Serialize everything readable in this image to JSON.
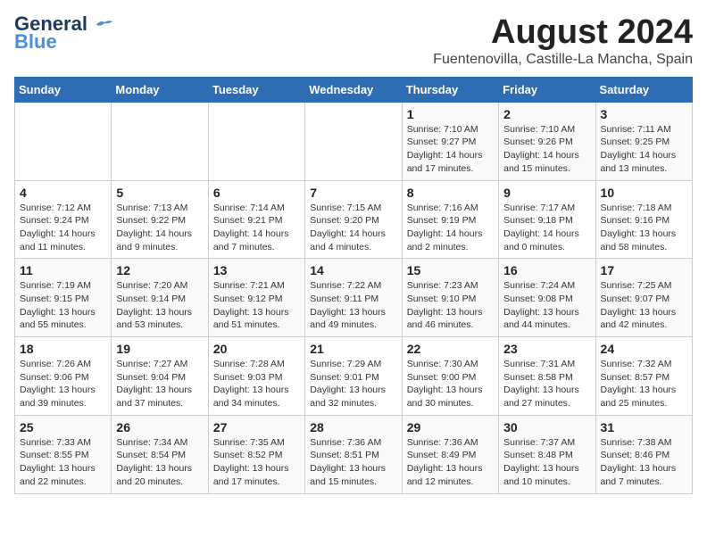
{
  "header": {
    "logo_line1": "General",
    "logo_line2": "Blue",
    "month_title": "August 2024",
    "location": "Fuentenovilla, Castille-La Mancha, Spain"
  },
  "weekdays": [
    "Sunday",
    "Monday",
    "Tuesday",
    "Wednesday",
    "Thursday",
    "Friday",
    "Saturday"
  ],
  "weeks": [
    [
      {
        "day": "",
        "info": ""
      },
      {
        "day": "",
        "info": ""
      },
      {
        "day": "",
        "info": ""
      },
      {
        "day": "",
        "info": ""
      },
      {
        "day": "1",
        "info": "Sunrise: 7:10 AM\nSunset: 9:27 PM\nDaylight: 14 hours and 17 minutes."
      },
      {
        "day": "2",
        "info": "Sunrise: 7:10 AM\nSunset: 9:26 PM\nDaylight: 14 hours and 15 minutes."
      },
      {
        "day": "3",
        "info": "Sunrise: 7:11 AM\nSunset: 9:25 PM\nDaylight: 14 hours and 13 minutes."
      }
    ],
    [
      {
        "day": "4",
        "info": "Sunrise: 7:12 AM\nSunset: 9:24 PM\nDaylight: 14 hours and 11 minutes."
      },
      {
        "day": "5",
        "info": "Sunrise: 7:13 AM\nSunset: 9:22 PM\nDaylight: 14 hours and 9 minutes."
      },
      {
        "day": "6",
        "info": "Sunrise: 7:14 AM\nSunset: 9:21 PM\nDaylight: 14 hours and 7 minutes."
      },
      {
        "day": "7",
        "info": "Sunrise: 7:15 AM\nSunset: 9:20 PM\nDaylight: 14 hours and 4 minutes."
      },
      {
        "day": "8",
        "info": "Sunrise: 7:16 AM\nSunset: 9:19 PM\nDaylight: 14 hours and 2 minutes."
      },
      {
        "day": "9",
        "info": "Sunrise: 7:17 AM\nSunset: 9:18 PM\nDaylight: 14 hours and 0 minutes."
      },
      {
        "day": "10",
        "info": "Sunrise: 7:18 AM\nSunset: 9:16 PM\nDaylight: 13 hours and 58 minutes."
      }
    ],
    [
      {
        "day": "11",
        "info": "Sunrise: 7:19 AM\nSunset: 9:15 PM\nDaylight: 13 hours and 55 minutes."
      },
      {
        "day": "12",
        "info": "Sunrise: 7:20 AM\nSunset: 9:14 PM\nDaylight: 13 hours and 53 minutes."
      },
      {
        "day": "13",
        "info": "Sunrise: 7:21 AM\nSunset: 9:12 PM\nDaylight: 13 hours and 51 minutes."
      },
      {
        "day": "14",
        "info": "Sunrise: 7:22 AM\nSunset: 9:11 PM\nDaylight: 13 hours and 49 minutes."
      },
      {
        "day": "15",
        "info": "Sunrise: 7:23 AM\nSunset: 9:10 PM\nDaylight: 13 hours and 46 minutes."
      },
      {
        "day": "16",
        "info": "Sunrise: 7:24 AM\nSunset: 9:08 PM\nDaylight: 13 hours and 44 minutes."
      },
      {
        "day": "17",
        "info": "Sunrise: 7:25 AM\nSunset: 9:07 PM\nDaylight: 13 hours and 42 minutes."
      }
    ],
    [
      {
        "day": "18",
        "info": "Sunrise: 7:26 AM\nSunset: 9:06 PM\nDaylight: 13 hours and 39 minutes."
      },
      {
        "day": "19",
        "info": "Sunrise: 7:27 AM\nSunset: 9:04 PM\nDaylight: 13 hours and 37 minutes."
      },
      {
        "day": "20",
        "info": "Sunrise: 7:28 AM\nSunset: 9:03 PM\nDaylight: 13 hours and 34 minutes."
      },
      {
        "day": "21",
        "info": "Sunrise: 7:29 AM\nSunset: 9:01 PM\nDaylight: 13 hours and 32 minutes."
      },
      {
        "day": "22",
        "info": "Sunrise: 7:30 AM\nSunset: 9:00 PM\nDaylight: 13 hours and 30 minutes."
      },
      {
        "day": "23",
        "info": "Sunrise: 7:31 AM\nSunset: 8:58 PM\nDaylight: 13 hours and 27 minutes."
      },
      {
        "day": "24",
        "info": "Sunrise: 7:32 AM\nSunset: 8:57 PM\nDaylight: 13 hours and 25 minutes."
      }
    ],
    [
      {
        "day": "25",
        "info": "Sunrise: 7:33 AM\nSunset: 8:55 PM\nDaylight: 13 hours and 22 minutes."
      },
      {
        "day": "26",
        "info": "Sunrise: 7:34 AM\nSunset: 8:54 PM\nDaylight: 13 hours and 20 minutes."
      },
      {
        "day": "27",
        "info": "Sunrise: 7:35 AM\nSunset: 8:52 PM\nDaylight: 13 hours and 17 minutes."
      },
      {
        "day": "28",
        "info": "Sunrise: 7:36 AM\nSunset: 8:51 PM\nDaylight: 13 hours and 15 minutes."
      },
      {
        "day": "29",
        "info": "Sunrise: 7:36 AM\nSunset: 8:49 PM\nDaylight: 13 hours and 12 minutes."
      },
      {
        "day": "30",
        "info": "Sunrise: 7:37 AM\nSunset: 8:48 PM\nDaylight: 13 hours and 10 minutes."
      },
      {
        "day": "31",
        "info": "Sunrise: 7:38 AM\nSunset: 8:46 PM\nDaylight: 13 hours and 7 minutes."
      }
    ]
  ]
}
